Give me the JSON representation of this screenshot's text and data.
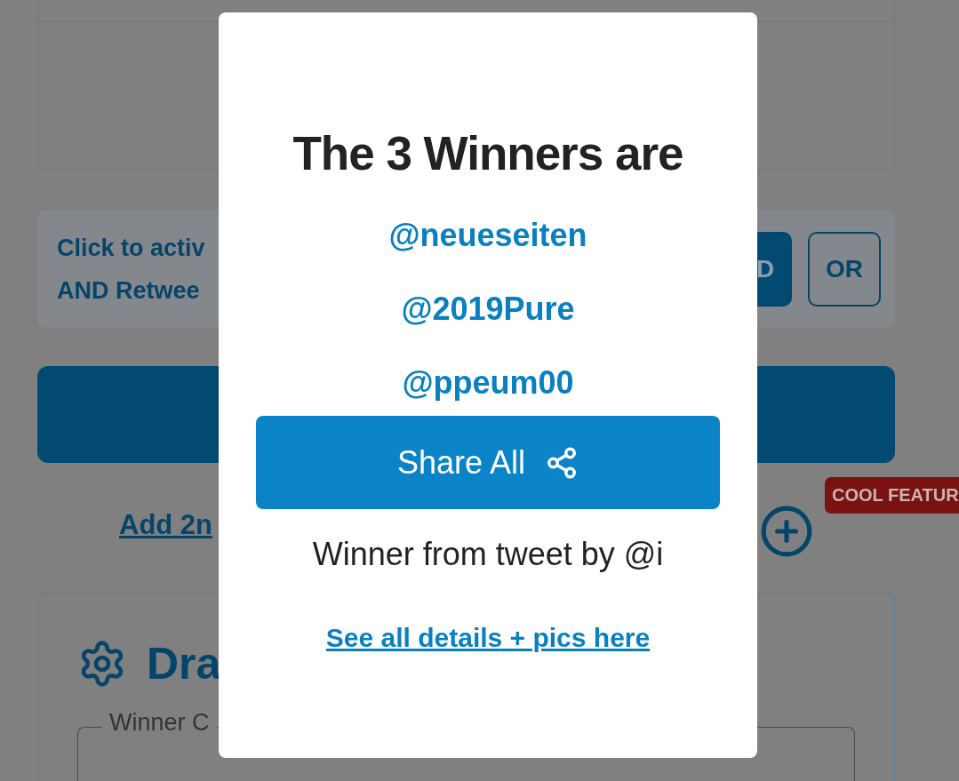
{
  "background": {
    "filter_box": {
      "text_lines": [
        "Click to activ",
        "AND Retwee"
      ],
      "buttons": [
        {
          "label": "D",
          "selected": true
        },
        {
          "label": "OR",
          "selected": false
        }
      ]
    },
    "add_link": "Add 2n",
    "badge": "COOL FEATUR",
    "settings_card": {
      "title": "Dra",
      "field_label": "Winner C"
    }
  },
  "modal": {
    "title": "The 3 Winners are",
    "winners": [
      "@neueseiten",
      "@2019Pure",
      "@ppeum00"
    ],
    "share_button": "Share All",
    "note": "Winner from tweet by @i",
    "details_link": "See all details + pics here"
  }
}
